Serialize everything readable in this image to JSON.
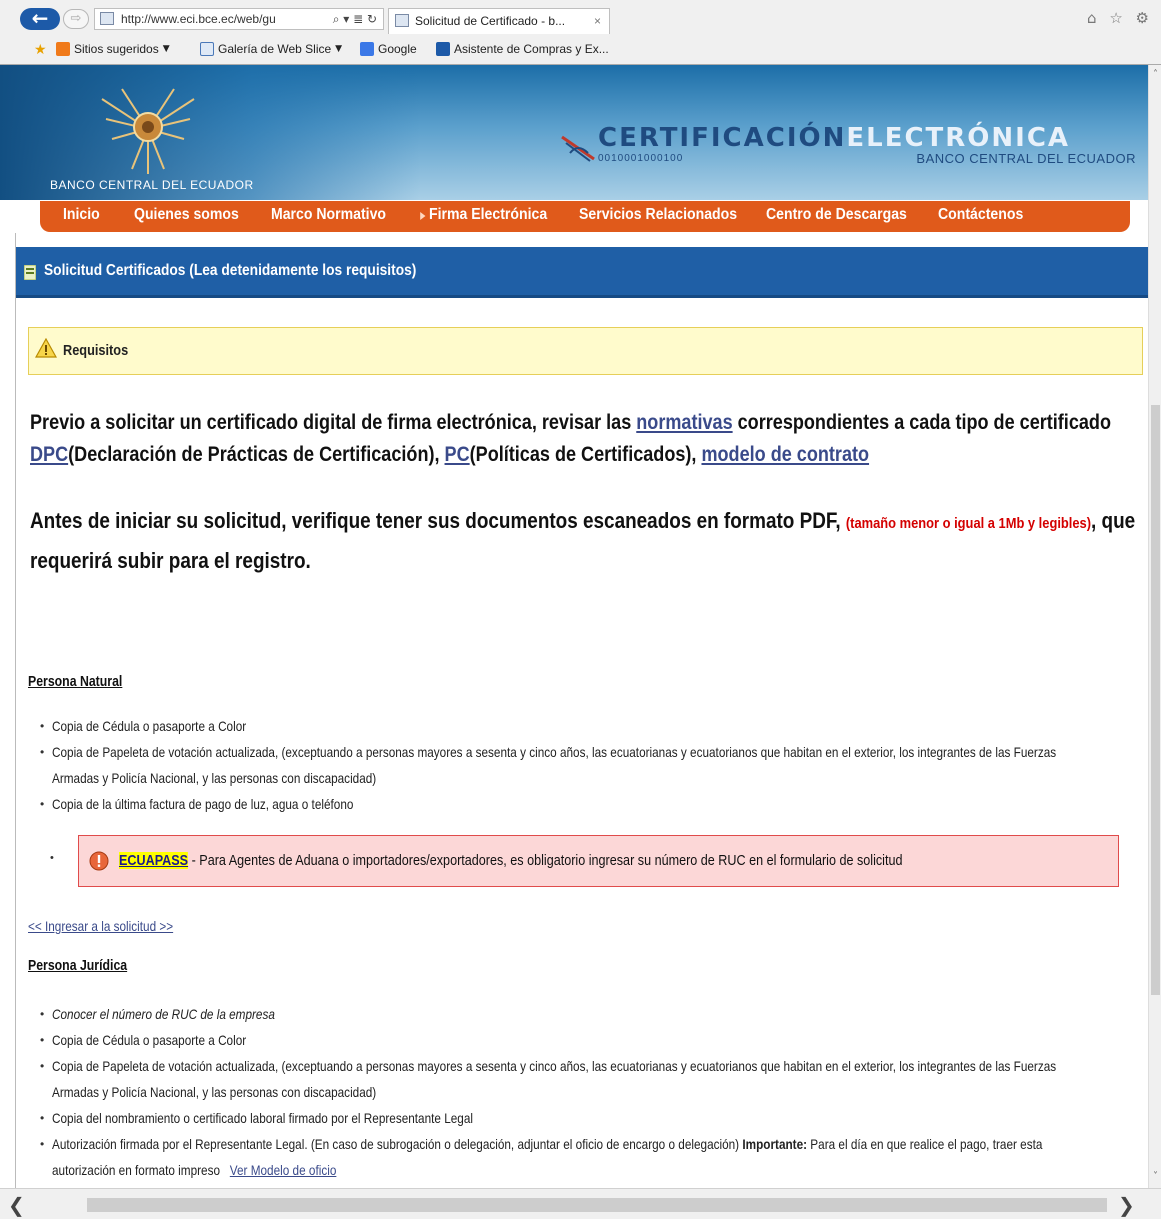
{
  "browser": {
    "url": "http://www.eci.bce.ec/web/gu",
    "address_tools": "⌕ ▾ ≣ ↻",
    "tab_title": "Solicitud de Certificado - b...",
    "tab_close": "×",
    "toolbar_icons": "⌂ ☆ ⚙",
    "favorites": {
      "suggested_sites": "Sitios sugeridos",
      "web_slice_gallery": "Galería de Web Slice",
      "google": "Google",
      "shopping_assistant": "Asistente de Compras y Ex..."
    }
  },
  "header": {
    "bank_name_left": "BANCO CENTRAL DEL ECUADOR",
    "cert_title_a": "CERTIFICACIÓN",
    "cert_title_b": "ELECTRÓNICA",
    "cert_binary": "0010001000100",
    "cert_bank": "BANCO CENTRAL DEL ECUADOR"
  },
  "menu": {
    "items": [
      {
        "label": "Inicio"
      },
      {
        "label": "Quienes somos"
      },
      {
        "label": "Marco Normativo"
      },
      {
        "label": "Firma Electrónica"
      },
      {
        "label": "Servicios Relacionados"
      },
      {
        "label": "Centro de Descargas"
      },
      {
        "label": "Contáctenos"
      }
    ]
  },
  "page": {
    "section_header": "Solicitud Certificados (Lea detenidamente los requisitos)",
    "requirements_label": "Requisitos",
    "intro": {
      "t1": "Previo a solicitar un certificado digital de firma electrónica, revisar las ",
      "link_normativas": "normativas",
      "t2": " correspondientes a cada tipo de certificado ",
      "link_dpc": "DPC",
      "t3": "(Declaración de Prácticas de Certificación), ",
      "link_pc": "PC",
      "t4": "(Políticas de Certificados), ",
      "link_contrato": "modelo de contrato"
    },
    "scan_note": {
      "t1": "Antes de iniciar su solicitud, verifique tener sus documentos escaneados en formato PDF, ",
      "red": "(tamaño menor o igual a 1Mb y legibles)",
      "t2": ", que requerirá subir para el registro."
    },
    "natural": {
      "title": "Persona Natural",
      "items": [
        "Copia de Cédula o pasaporte a Color",
        "Copia de Papeleta de votación actualizada, (exceptuando a personas mayores a sesenta y cinco años, las ecuatorianas y ecuatorianos que habitan en el exterior, los integrantes de las Fuerzas",
        "Armadas y Policía Nacional, y las personas con discapacidad)",
        "Copia de la última factura de pago de luz, agua o teléfono"
      ]
    },
    "ecuapass": {
      "tag": "ECUAPASS",
      "text": " - Para Agentes de Aduana o importadores/exportadores, es obligatorio ingresar su número de RUC en el formulario de solicitud"
    },
    "ingresar_link": "<< Ingresar a la solicitud >>",
    "juridica": {
      "title": "Persona Jurídica",
      "items": [
        "Conocer el número de RUC de la empresa",
        "Copia de Cédula o pasaporte a Color",
        "Copia de Papeleta de votación actualizada, (exceptuando a personas mayores a sesenta y cinco años, las ecuatorianas y ecuatorianos que habitan en el exterior, los integrantes de las Fuerzas",
        "Armadas y Policía Nacional, y las personas con discapacidad)",
        "Copia del nombramiento o certificado laboral firmado por el Representante Legal",
        "Autorización firmada por el Representante Legal. (En caso de subrogación o delegación, adjuntar el oficio de encargo o delegación) ",
        "Importante:",
        " Para el día en que realice el pago, traer esta",
        "autorización en formato impreso",
        "Ver Modelo de oficio"
      ]
    }
  },
  "colors": {
    "menu_orange": "#e05a1b",
    "header_blue": "#1f5fa6",
    "warning_yellow": "#fffbcc",
    "alert_red": "#fcd7d7",
    "link_blue": "#3a4a8a"
  },
  "icons": {
    "back": "←",
    "forward": "⇨",
    "scroll_left": "❮",
    "scroll_right": "❯",
    "scroll_up": "˄",
    "scroll_down": "˅",
    "bullet": "•",
    "fav_star": "★",
    "caret": "▼"
  }
}
